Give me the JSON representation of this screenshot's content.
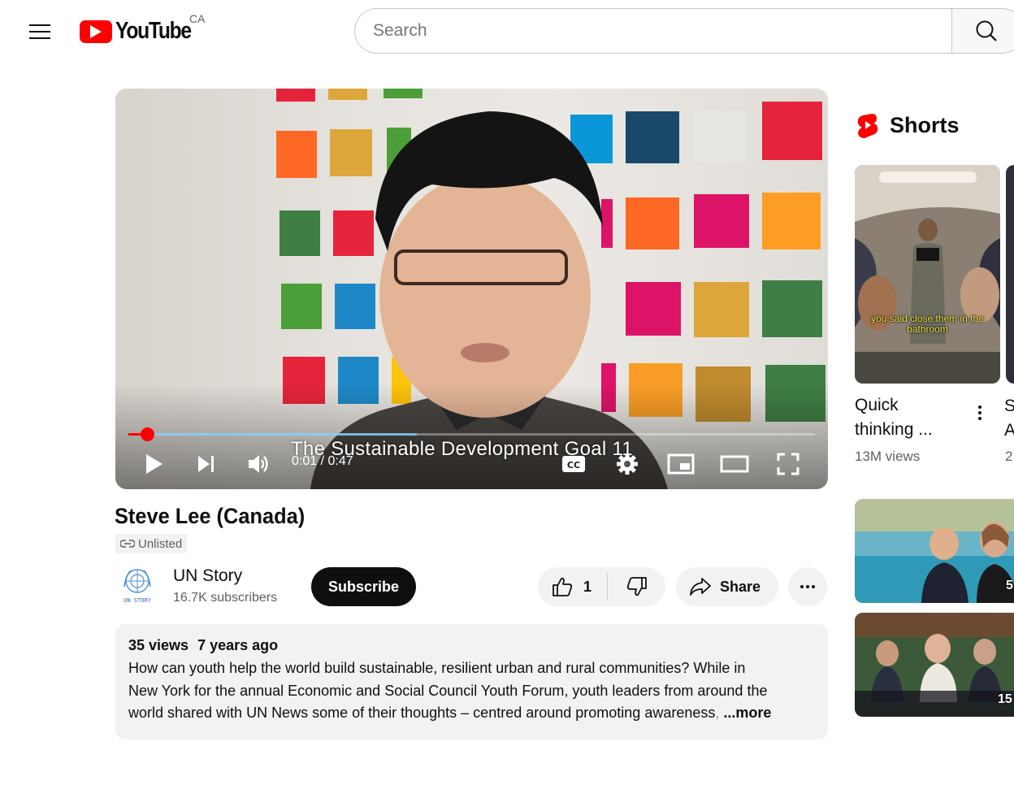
{
  "header": {
    "logo_text": "YouTube",
    "region": "CA",
    "search_placeholder": "Search",
    "icons": [
      "menu-icon",
      "youtube-logo-icon",
      "search-icon"
    ]
  },
  "player": {
    "subtitle": "The Sustainable Development Goal 11",
    "time_display": "0:01 / 0:47",
    "progress_fraction": 0.027,
    "buffered_fraction": 0.42,
    "icons": [
      "play-icon",
      "next-icon",
      "volume-icon",
      "closed-captions-icon",
      "settings-icon",
      "miniplayer-icon",
      "theater-mode-icon",
      "fullscreen-icon"
    ]
  },
  "video": {
    "title": "Steve Lee (Canada)",
    "visibility_badge": "Unlisted",
    "channel_name": "UN Story",
    "channel_subscribers": "16.7K subscribers",
    "channel_avatar_text": "UN STORY",
    "subscribe_label": "Subscribe",
    "like_count": "1",
    "share_label": "Share",
    "views": "35 views",
    "uploaded": "7 years ago",
    "description_line1": "How can youth help the world build sustainable, resilient urban and rural communities? While in",
    "description_line2": "New York for the annual Economic and Social Council Youth Forum, youth leaders from around the",
    "description_line3": "world shared with UN News some of their thoughts – centred around promoting awareness",
    "description_fade": ",",
    "more_label": "...more"
  },
  "shorts": {
    "section_title": "Shorts",
    "first": {
      "caption": "you said close them in the bathroom",
      "title_line1": "Quick",
      "title_line2": "thinking ...",
      "views": "13M views"
    },
    "second_partial": {
      "title_char1": "S",
      "title_char2": "A",
      "views_char": "2"
    },
    "videos": [
      {
        "count_partial": "5"
      },
      {
        "count_partial": "15"
      }
    ]
  },
  "colors": {
    "youtube_red": "#ff0000",
    "text_primary": "#0f0f0f",
    "text_secondary": "#606060",
    "chip_bg": "#f2f2f2"
  }
}
